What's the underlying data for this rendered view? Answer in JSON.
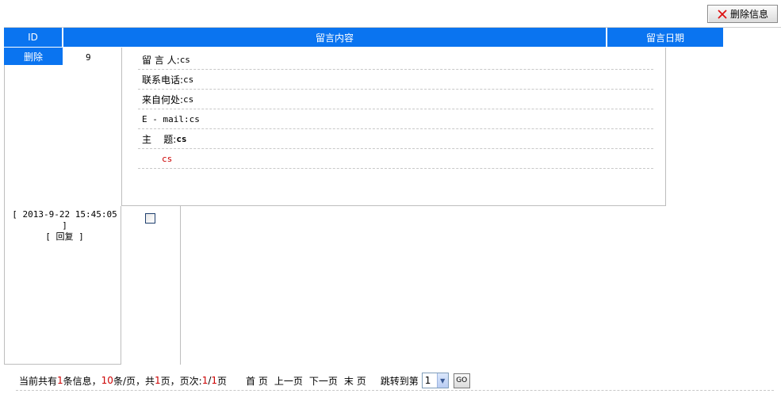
{
  "toolbar": {
    "delete_info_label": "删除信息",
    "delete_icon": "x-icon"
  },
  "table": {
    "headers": {
      "id": "ID",
      "content": "留言内容",
      "date": "留言日期"
    },
    "row": {
      "delete_label": "删除",
      "id": "9",
      "fields": [
        {
          "label": "留 言 人:",
          "value": "cs"
        },
        {
          "label": "联系电话:",
          "value": "cs"
        },
        {
          "label": "来自何处:",
          "value": "cs"
        },
        {
          "label": "E - mail:",
          "value": "cs"
        },
        {
          "label": "主    题:",
          "value": "cs"
        }
      ],
      "message": "cs",
      "date": "[ 2013-9-22 15:45:05 ]",
      "reply": "[ 回复 ]",
      "checked": false
    }
  },
  "pager": {
    "prefix": "当前共有",
    "total": "1",
    "mid1": "条信息，",
    "per_page": "10",
    "mid2": "条/页，共",
    "pages": "1",
    "mid3": "页，页次:",
    "current": "1",
    "slash": "/",
    "pages2": "1",
    "suffix": "页",
    "first": "首 页",
    "prev": "上一页",
    "next": "下一页",
    "last": "末 页",
    "jump_label": "跳转到第",
    "jump_value": "1",
    "go": "GO"
  },
  "colors": {
    "header_bg": "#0a74f0",
    "accent_red": "#cc0000"
  }
}
